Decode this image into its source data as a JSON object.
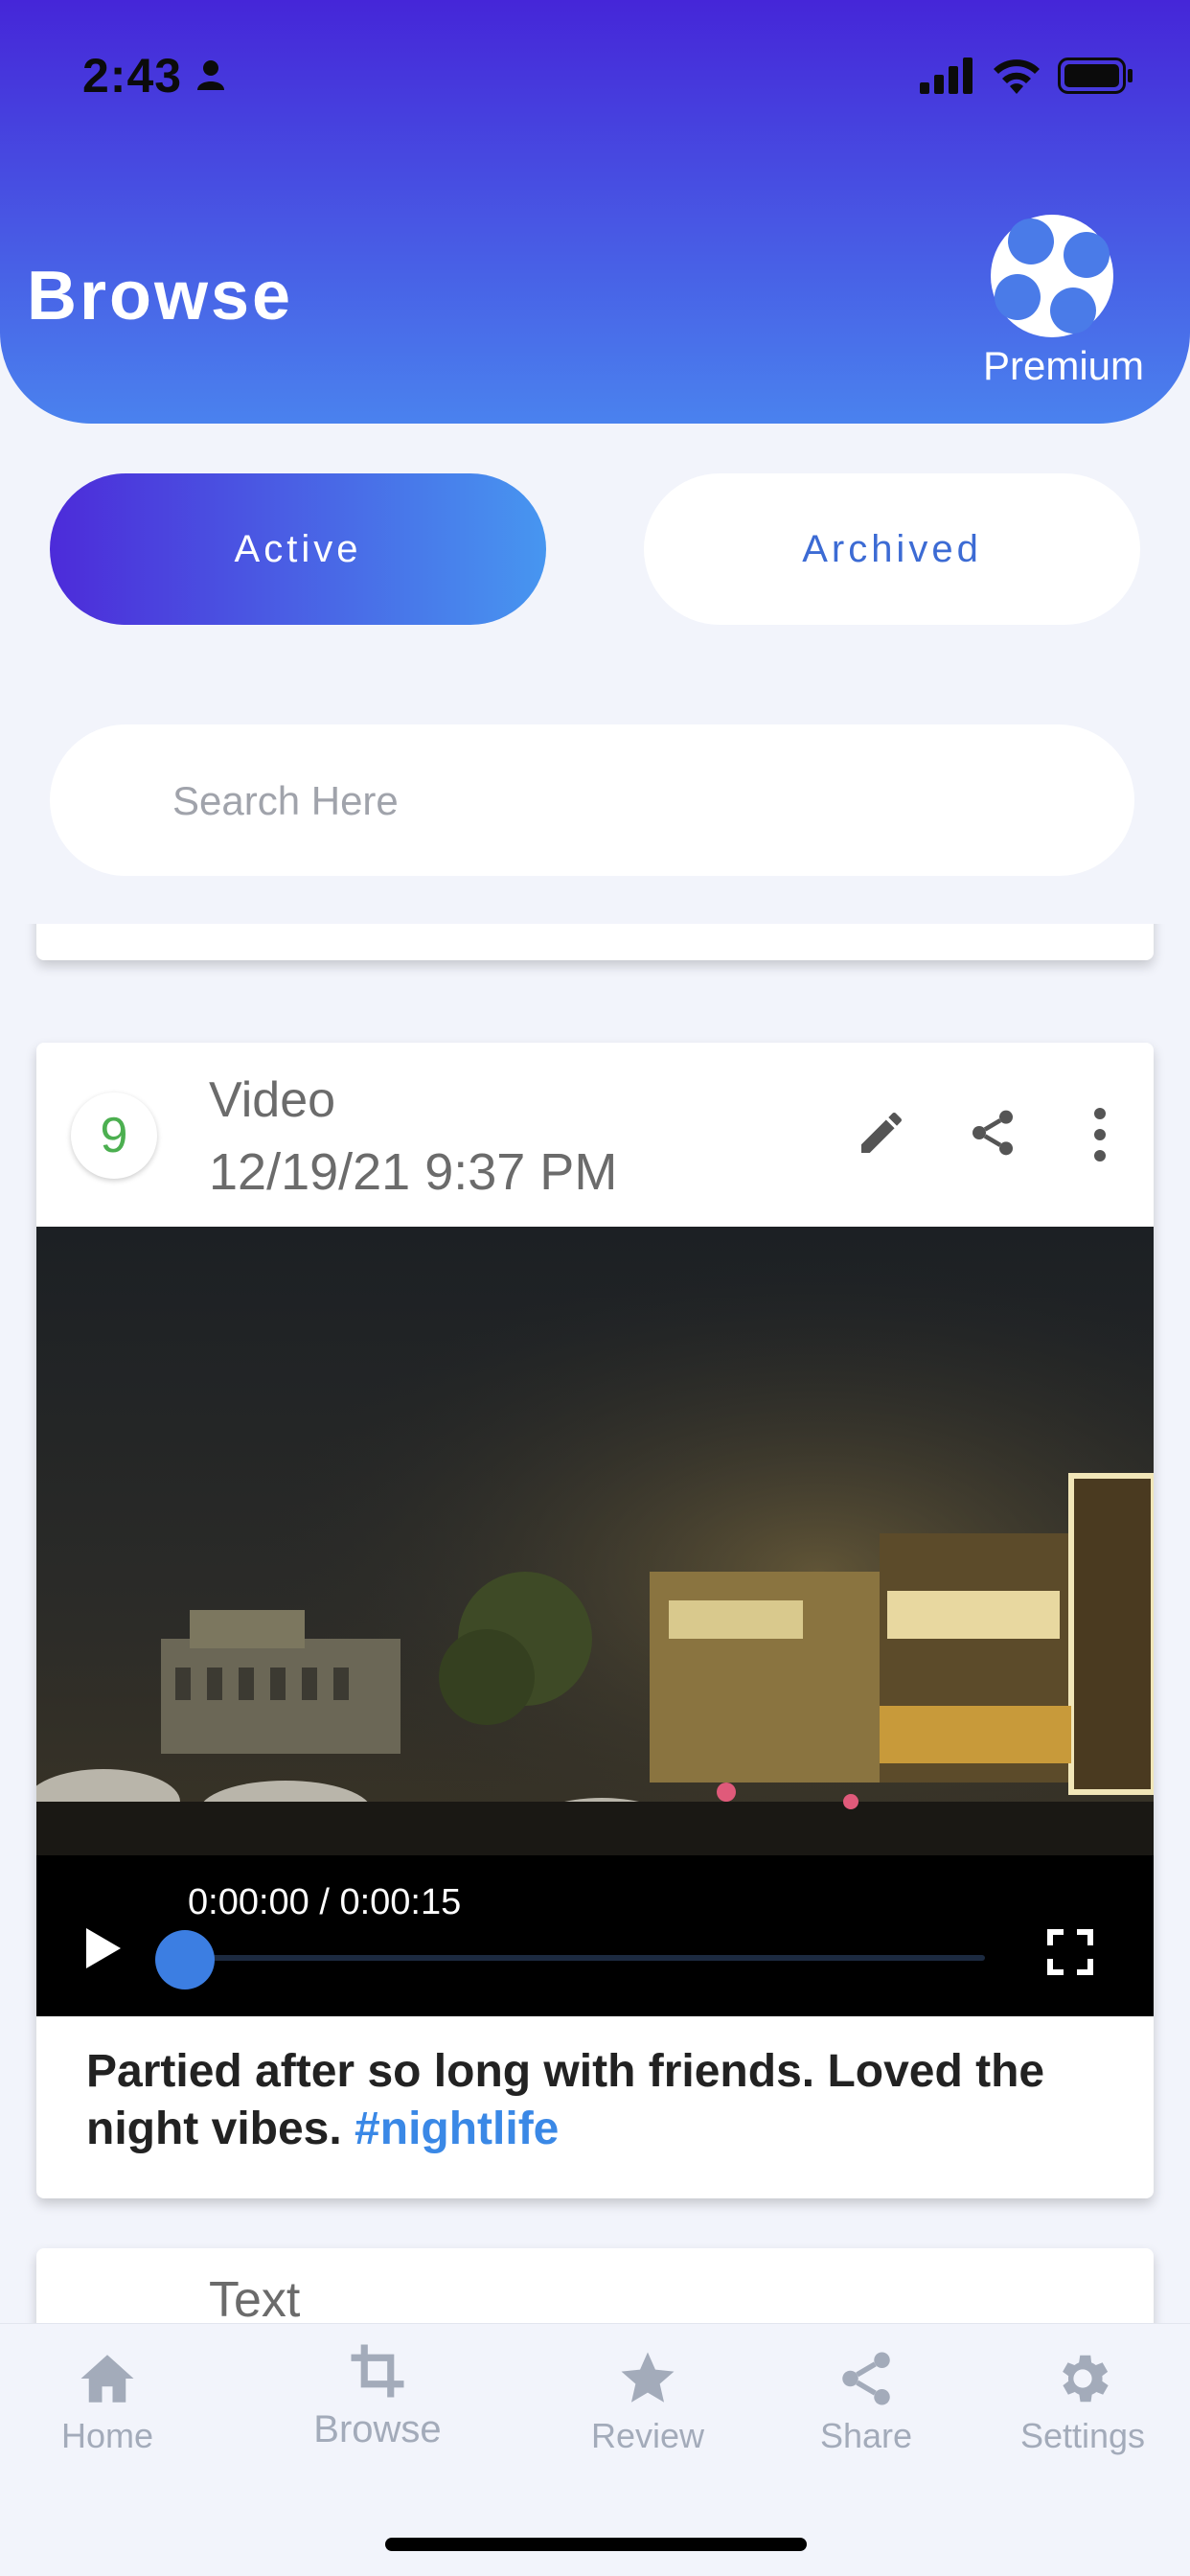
{
  "status_bar": {
    "time": "2:43"
  },
  "header": {
    "title": "Browse",
    "badge_label": "Premium"
  },
  "segments": {
    "active": "Active",
    "archived": "Archived",
    "selected": "Active"
  },
  "search": {
    "placeholder": "Search Here",
    "value": ""
  },
  "entries": [
    {
      "number": "9",
      "type": "Video",
      "date": "12/19/21 9:37 PM",
      "video": {
        "time_readout": "0:00:00 / 0:00:15",
        "progress": 0
      },
      "caption": "Partied after so long with friends. Loved the night vibes.",
      "hashtag": "#nightlife"
    },
    {
      "type": "Text"
    }
  ],
  "tabbar": {
    "items": [
      {
        "label": "Home",
        "icon": "home-icon"
      },
      {
        "label": "Browse",
        "icon": "crop-icon"
      },
      {
        "label": "Review",
        "icon": "star-icon"
      },
      {
        "label": "Share",
        "icon": "share-icon"
      },
      {
        "label": "Settings",
        "icon": "gear-icon"
      }
    ]
  },
  "colors": {
    "header_gradient_start": "#4526d8",
    "header_gradient_end": "#4a82ee",
    "accent_blue": "#3c7ee2",
    "number_green": "#4caf50",
    "hashtag_blue": "#3a88e6",
    "tab_inactive": "#a3abba"
  }
}
